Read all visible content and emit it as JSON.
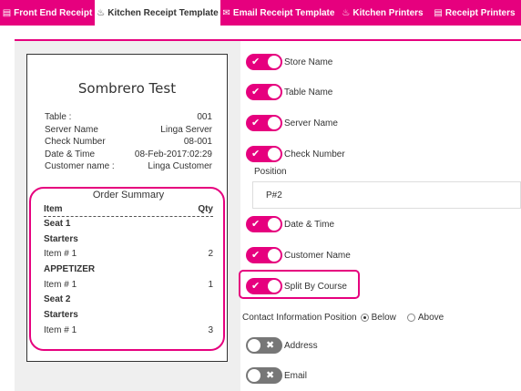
{
  "tabs": [
    {
      "label": "Front End Receipt",
      "icon": "receipt-icon",
      "active": false
    },
    {
      "label": "Kitchen Receipt Template",
      "icon": "chef-hat-icon",
      "active": true
    },
    {
      "label": "Email Receipt Template",
      "icon": "envelope-icon",
      "active": false
    },
    {
      "label": "Kitchen Printers",
      "icon": "chef-hat-icon",
      "active": false
    },
    {
      "label": "Receipt Printers",
      "icon": "receipt-icon",
      "active": false
    }
  ],
  "receipt": {
    "title": "Sombrero Test",
    "info": [
      {
        "label": "Table :",
        "value": "001"
      },
      {
        "label": "Server Name",
        "value": "Linga Server"
      },
      {
        "label": "Check Number",
        "value": "08-001"
      },
      {
        "label": "Date & Time",
        "value": "08-Feb-2017:02:29"
      },
      {
        "label": "Customer name :",
        "value": "Linga Customer"
      }
    ],
    "order_summary": {
      "title": "Order Summary",
      "col_item": "Item",
      "col_qty": "Qty",
      "lines": [
        {
          "text": "Seat 1",
          "qty": "",
          "bold": true
        },
        {
          "text": "Starters",
          "qty": "",
          "bold": true
        },
        {
          "text": "Item # 1",
          "qty": "2",
          "bold": false
        },
        {
          "text": "APPETIZER",
          "qty": "",
          "bold": true
        },
        {
          "text": "Item # 1",
          "qty": "1",
          "bold": false
        },
        {
          "text": "Seat 2",
          "qty": "",
          "bold": true
        },
        {
          "text": "Starters",
          "qty": "",
          "bold": true
        },
        {
          "text": "Item # 1",
          "qty": "3",
          "bold": false
        }
      ]
    }
  },
  "settings": {
    "store_name": {
      "label": "Store Name",
      "on": true
    },
    "table_name": {
      "label": "Table Name",
      "on": true
    },
    "server_name": {
      "label": "Server Name",
      "on": true
    },
    "check_number": {
      "label": "Check Number",
      "on": true
    },
    "position": {
      "label": "Position",
      "value": "P#2"
    },
    "date_time": {
      "label": "Date & Time",
      "on": true
    },
    "customer_name": {
      "label": "Customer Name",
      "on": true
    },
    "split_by_course": {
      "label": "Split By Course",
      "on": true
    },
    "contact_position": {
      "label": "Contact Information Position",
      "options": [
        "Below",
        "Above"
      ],
      "selected": "Below"
    },
    "address": {
      "label": "Address",
      "on": false
    },
    "email": {
      "label": "Email",
      "on": false
    }
  },
  "colors": {
    "accent": "#e6007e",
    "toggle_off": "#777777"
  }
}
